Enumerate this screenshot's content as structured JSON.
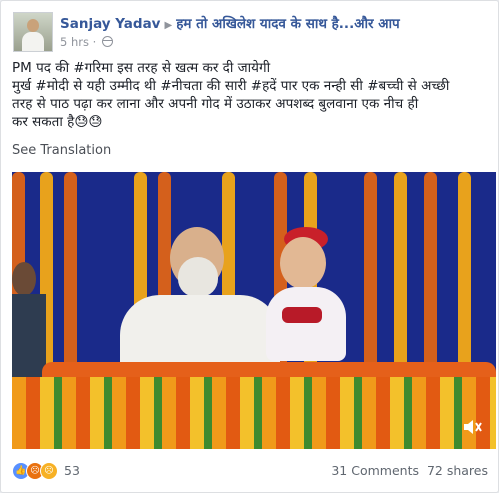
{
  "post": {
    "author": "Sanjay Yadav",
    "target": "हम तो अखिलेश यादव के साथ है...और आप",
    "time": "5 hrs",
    "text_line1": "PM पद की #गरिमा इस तरह से खत्म कर दी जायेगी",
    "text_line2": "मुर्ख #मोदी से यही उम्मीद थी #नीचता की सारी #हदें पार एक नन्ही सी #बच्ची से अच्छी",
    "text_line3": "तरह से पाठ पढ़ा कर लाना और अपनी गोद में उठाकर अपशब्द बुलवाना एक नीच ही",
    "text_line4": "कर सकता है😓😓",
    "see_translation": "See Translation"
  },
  "footer": {
    "reaction_count": "53",
    "comments": "31 Comments",
    "shares": "72 shares"
  },
  "icons": [
    "globe-icon",
    "like-icon",
    "angry-icon",
    "sad-icon",
    "speaker-icon"
  ],
  "colors": {
    "link": "#365899",
    "meta": "#90949c",
    "like": "#5890ff",
    "angry": "#e9710f",
    "sad": "#f7b125"
  }
}
